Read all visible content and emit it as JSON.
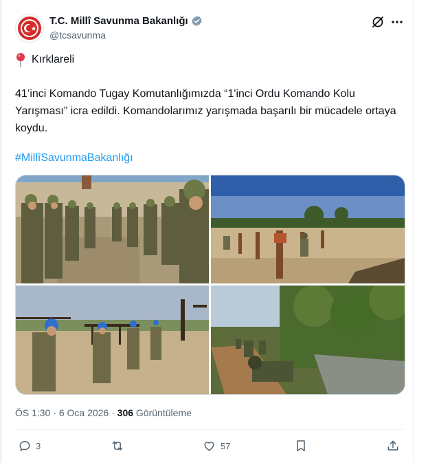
{
  "account": {
    "display_name": "T.C. Millî Savunma Bakanlığı",
    "handle": "@tcsavunma",
    "avatar_icon": "ministry-seal-icon",
    "verified_icon": "verified-badge-icon",
    "verified_color": "#829aab"
  },
  "header_actions": {
    "grok_icon": "grok-icon",
    "more_icon": "more-dots-icon"
  },
  "location": {
    "icon": "round-pushpin-icon",
    "text": "Kırklareli"
  },
  "tweet": {
    "text": "41’inci Komando Tugay Komutanlığımızda “1'inci Ordu Komando Kolu Yarışması” icra edildi. Komandolarımız yarışmada başarılı bir mücadele ortaya koydu.",
    "hashtag": "#MillîSavunmaBakanlığı",
    "link_color": "#1d9bf0"
  },
  "media": {
    "photos": [
      "soldiers-formation-photo",
      "obstacle-course-photo",
      "rope-training-photo",
      "crawling-exercise-photo"
    ]
  },
  "meta": {
    "time": "ÖS 1:30",
    "separator": "·",
    "date": "6 Oca 2026",
    "views_count": "306",
    "views_label": "Görüntüleme"
  },
  "actions": {
    "reply_count": "3",
    "retweet_count": "",
    "like_count": "57"
  }
}
